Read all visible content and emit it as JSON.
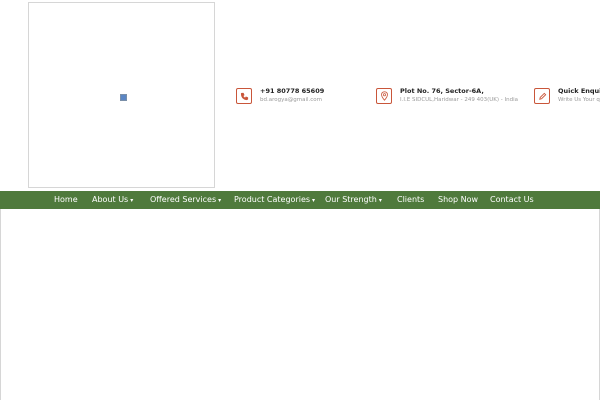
{
  "header": {
    "logo_alt": "",
    "contacts": [
      {
        "icon": "phone-icon",
        "title": "+91 80778 65609",
        "subtitle": "bd.arogya@gmail.com"
      },
      {
        "icon": "map-pin-icon",
        "title": "Plot No. 76, Sector-6A,",
        "subtitle": "I.I.E SIDCUL,Haridwar - 249 403(UK) - India"
      },
      {
        "icon": "pencil-icon",
        "title": "Quick Enquiry",
        "subtitle": "Write Us Your q"
      }
    ]
  },
  "nav": {
    "items": [
      {
        "label": "Home",
        "dropdown": false
      },
      {
        "label": "About Us",
        "dropdown": true
      },
      {
        "label": "Offered Services",
        "dropdown": true
      },
      {
        "label": "Product Categories",
        "dropdown": true
      },
      {
        "label": "Our Strength",
        "dropdown": true
      },
      {
        "label": "Clients",
        "dropdown": false
      },
      {
        "label": "Shop Now",
        "dropdown": false
      },
      {
        "label": "Contact Us",
        "dropdown": false
      }
    ],
    "caret_glyph": "▾"
  },
  "colors": {
    "nav_background": "#4f7a3c",
    "icon_accent": "#c9563a"
  }
}
